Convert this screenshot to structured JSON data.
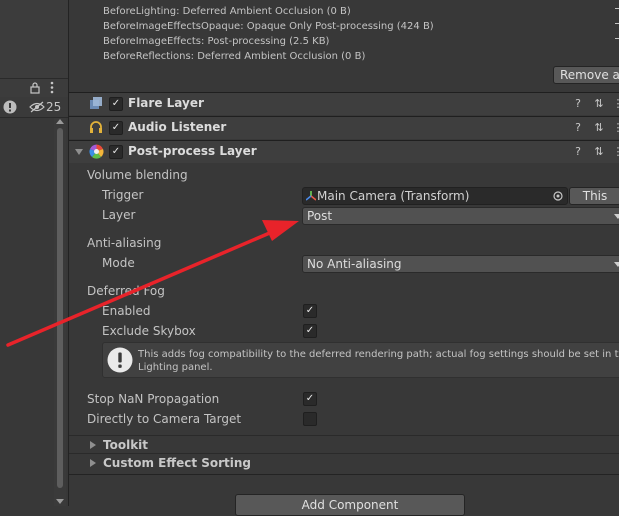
{
  "left_panel": {
    "lock_icon": "lock-icon",
    "menu_icon": "kebab-menu-icon",
    "info_icon": "info-icon",
    "visibility_icon": "hidden-eye-icon",
    "hidden_count": "25"
  },
  "log_lines": [
    "BeforeLighting: Deferred Ambient Occlusion (0 B)",
    "BeforeImageEffectsOpaque: Opaque Only Post-processing (424 B)",
    "BeforeImageEffects: Post-processing (2.5 KB)",
    "BeforeReflections: Deferred Ambient Occlusion (0 B)"
  ],
  "remove_all_label": "Remove al",
  "components": [
    {
      "title": "Flare Layer",
      "icon": "flare-layer-icon"
    },
    {
      "title": "Audio Listener",
      "icon": "headphones-icon"
    },
    {
      "title": "Post-process Layer",
      "icon": "post-process-icon"
    }
  ],
  "post_process": {
    "volume_blending": {
      "section": "Volume blending",
      "trigger_label": "Trigger",
      "trigger_value": "Main Camera (Transform)",
      "this_button": "This",
      "layer_label": "Layer",
      "layer_value": "Post"
    },
    "anti_aliasing": {
      "section": "Anti-aliasing",
      "mode_label": "Mode",
      "mode_value": "No Anti-aliasing"
    },
    "deferred_fog": {
      "section": "Deferred Fog",
      "enabled_label": "Enabled",
      "enabled": true,
      "exclude_skybox_label": "Exclude Skybox",
      "exclude_skybox": true,
      "help_text_1": "This adds fog compatibility to the deferred rendering path; actual fog settings should be set in the",
      "help_text_2": "Lighting panel."
    },
    "stop_nan_label": "Stop NaN Propagation",
    "stop_nan": true,
    "direct_camera_label": "Directly to Camera Target",
    "direct_camera": false,
    "toolkit": "Toolkit",
    "custom_sorting": "Custom Effect Sorting"
  },
  "add_component": "Add Component",
  "colors": {
    "annotation_arrow": "#e8232a",
    "panel_bg": "#383838"
  }
}
